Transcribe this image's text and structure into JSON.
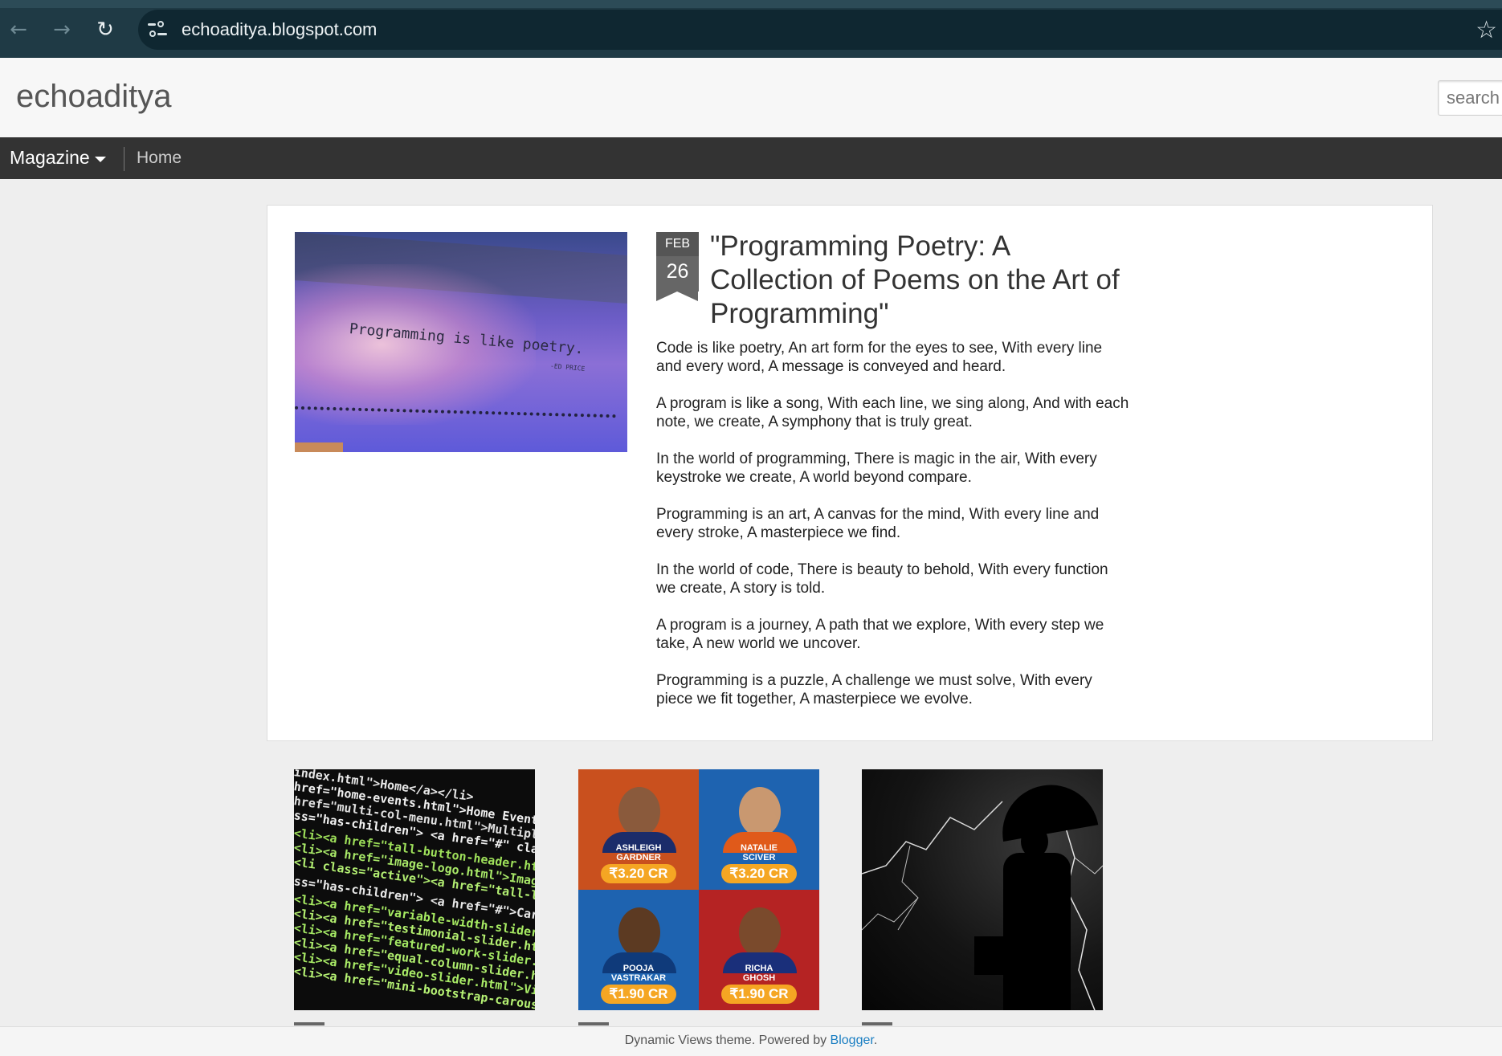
{
  "browser": {
    "url": "echoaditya.blogspot.com",
    "icons": {
      "back": "back-arrow-icon",
      "forward": "forward-arrow-icon",
      "reload": "reload-icon",
      "site_info": "site-info-icon",
      "bookmark": "bookmark-star-icon"
    }
  },
  "header": {
    "blog_title": "echoaditya",
    "search_placeholder": "search"
  },
  "navbar": {
    "view_label": "Magazine",
    "home_label": "Home"
  },
  "article": {
    "date_month": "FEB",
    "date_day": "26",
    "title": "\"Programming Poetry: A Collection of Poems on the Art of Programming\"",
    "image_text": "Programming is like poetry.",
    "image_author": "-ED PRICE",
    "paragraphs": [
      "Code is like poetry, An art form for the eyes to see, With every line and every word, A message is conveyed and heard.",
      "A program is like a song, With each line, we sing along, And with each note, we create, A symphony that is truly great.",
      "In the world of programming, There is magic in the air, With every keystroke we create, A world beyond compare.",
      "Programming is an art, A canvas for the mind, With every line and every stroke, A masterpiece we find.",
      "In the world of code, There is beauty to behold, With every function we create, A story is told.",
      "A program is a journey, A path that we explore, With every step we take, A new world we uncover.",
      "Programming is a puzzle, A challenge we must solve, With every piece we fit together, A masterpiece we evolve."
    ]
  },
  "thumbnails": {
    "code": {
      "lines": [
        "index.html\">Home</a></li>",
        "href=\"home-events.html\">Home Events</a></li>",
        "href=\"multi-col-menu.html\">Multiple Column M",
        "ss=\"has-children\"> <a href=\"#\" class=\"curre",
        "<li><a href=\"tall-button-header.html\">Tall",
        "<li><a href=\"image-logo.html\">Image Logo</",
        "<li class=\"active\"><a href=\"tall-logo.htm",
        "ss=\"has-children\"> <a href=\"#\">Carousels",
        "<li><a href=\"variable-width-slider.htm",
        "<li><a href=\"testimonial-slider.html\">",
        "<li><a href=\"featured-work-slider.htm",
        "<li><a href=\"equal-column-slider.html",
        "<li><a href=\"video-slider.html\">Video",
        "<li><a href=\"mini-bootstrap-carousel"
      ]
    },
    "cricket": {
      "cards": [
        {
          "name1": "ASHLEIGH",
          "name2": "GARDNER",
          "price": "₹3.20 CR"
        },
        {
          "name1": "NATALIE",
          "name2": "SCIVER",
          "price": "₹3.20 CR"
        },
        {
          "name1": "POOJA",
          "name2": "VASTRAKAR",
          "price": "₹1.90 CR"
        },
        {
          "name1": "RICHA",
          "name2": "GHOSH",
          "price": "₹1.90 CR"
        }
      ]
    }
  },
  "footer": {
    "text": "Dynamic Views theme. Powered by ",
    "link": "Blogger",
    "period": "."
  },
  "colors": {
    "chrome": "#1f3a45",
    "navbar": "#333333",
    "link": "#1a7ec2"
  }
}
